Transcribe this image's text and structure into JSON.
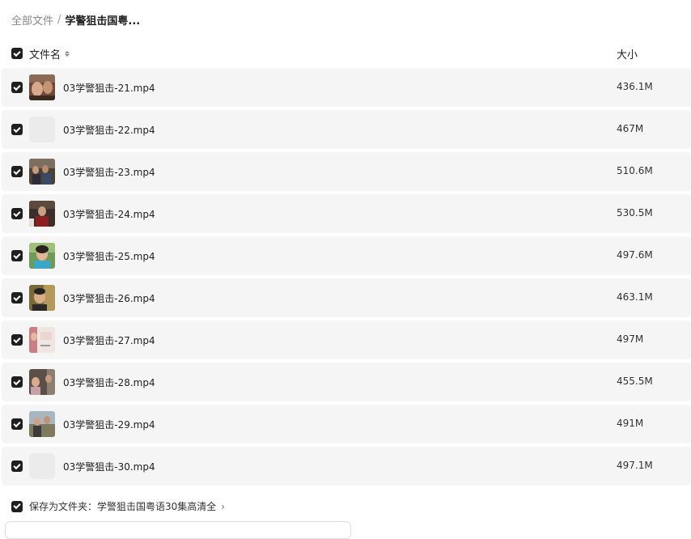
{
  "breadcrumb": {
    "root": "全部文件",
    "separator": "/",
    "current": "学警狙击国粤..."
  },
  "header": {
    "name_label": "文件名",
    "size_label": "大小"
  },
  "files": [
    {
      "name": "03学警狙击-21.mp4",
      "size": "436.1M",
      "thumb": "video-thumbnail"
    },
    {
      "name": "03学警狙击-22.mp4",
      "size": "467M",
      "thumb": "none"
    },
    {
      "name": "03学警狙击-23.mp4",
      "size": "510.6M",
      "thumb": "video-thumbnail"
    },
    {
      "name": "03学警狙击-24.mp4",
      "size": "530.5M",
      "thumb": "video-thumbnail"
    },
    {
      "name": "03学警狙击-25.mp4",
      "size": "497.6M",
      "thumb": "video-thumbnail"
    },
    {
      "name": "03学警狙击-26.mp4",
      "size": "463.1M",
      "thumb": "video-thumbnail"
    },
    {
      "name": "03学警狙击-27.mp4",
      "size": "497M",
      "thumb": "video-thumbnail"
    },
    {
      "name": "03学警狙击-28.mp4",
      "size": "455.5M",
      "thumb": "video-thumbnail"
    },
    {
      "name": "03学警狙击-29.mp4",
      "size": "491M",
      "thumb": "video-thumbnail"
    },
    {
      "name": "03学警狙击-30.mp4",
      "size": "497.1M",
      "thumb": "none"
    }
  ],
  "footer": {
    "save_label": "保存为文件夹：学警狙击国粤语30集高清全",
    "chevron": "›"
  },
  "colors": {
    "checkbox": "#1f1f1f",
    "row_background": "#f5f5f5",
    "muted_text": "#888888"
  }
}
